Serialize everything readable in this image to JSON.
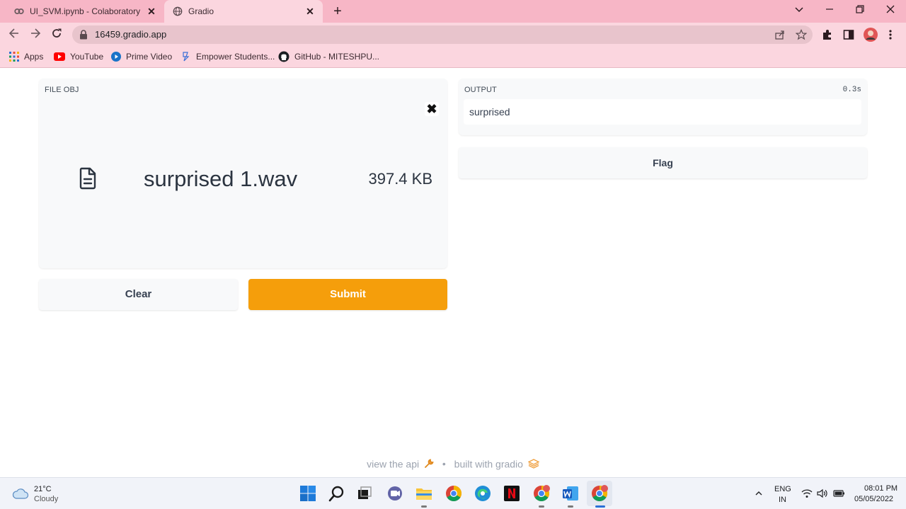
{
  "browser": {
    "tabs": [
      {
        "title": "UI_SVM.ipynb - Colaboratory",
        "active": false
      },
      {
        "title": "Gradio",
        "active": true
      }
    ],
    "new_tab_symbol": "+",
    "close_symbol": "✕",
    "address": "16459.gradio.app",
    "bookmarks": [
      {
        "label": "Apps",
        "icon": "apps-grid-icon"
      },
      {
        "label": "YouTube",
        "icon": "youtube-icon"
      },
      {
        "label": "Prime Video",
        "icon": "prime-video-icon"
      },
      {
        "label": "Empower Students...",
        "icon": "empower-icon"
      },
      {
        "label": "GitHub - MITESHPU...",
        "icon": "github-icon"
      }
    ],
    "theme_colors": {
      "tabbar": "#f7b6c6",
      "toolbar": "#fbd6df"
    }
  },
  "app": {
    "input": {
      "label": "FILE OBJ",
      "file_name": "surprised 1.wav",
      "file_size": "397.4 KB",
      "remove_symbol": "✖"
    },
    "buttons": {
      "clear": "Clear",
      "submit": "Submit",
      "flag": "Flag"
    },
    "output": {
      "label": "OUTPUT",
      "time": "0.3s",
      "value": "surprised"
    },
    "footer": {
      "api_text": "view the api",
      "separator": "•",
      "built_text": "built with gradio"
    },
    "colors": {
      "submit": "#f59e0b"
    }
  },
  "taskbar": {
    "weather_temp": "21°C",
    "weather_desc": "Cloudy",
    "language_1": "ENG",
    "language_2": "IN",
    "time": "08:01 PM",
    "date": "05/05/2022",
    "apps": [
      "windows-start-icon",
      "search-icon",
      "task-view-icon",
      "teams-chat-icon",
      "file-explorer-icon",
      "chrome-icon",
      "edge-icon",
      "netflix-icon",
      "chrome-profile-icon",
      "word-icon",
      "chrome-profile-active-icon"
    ]
  }
}
